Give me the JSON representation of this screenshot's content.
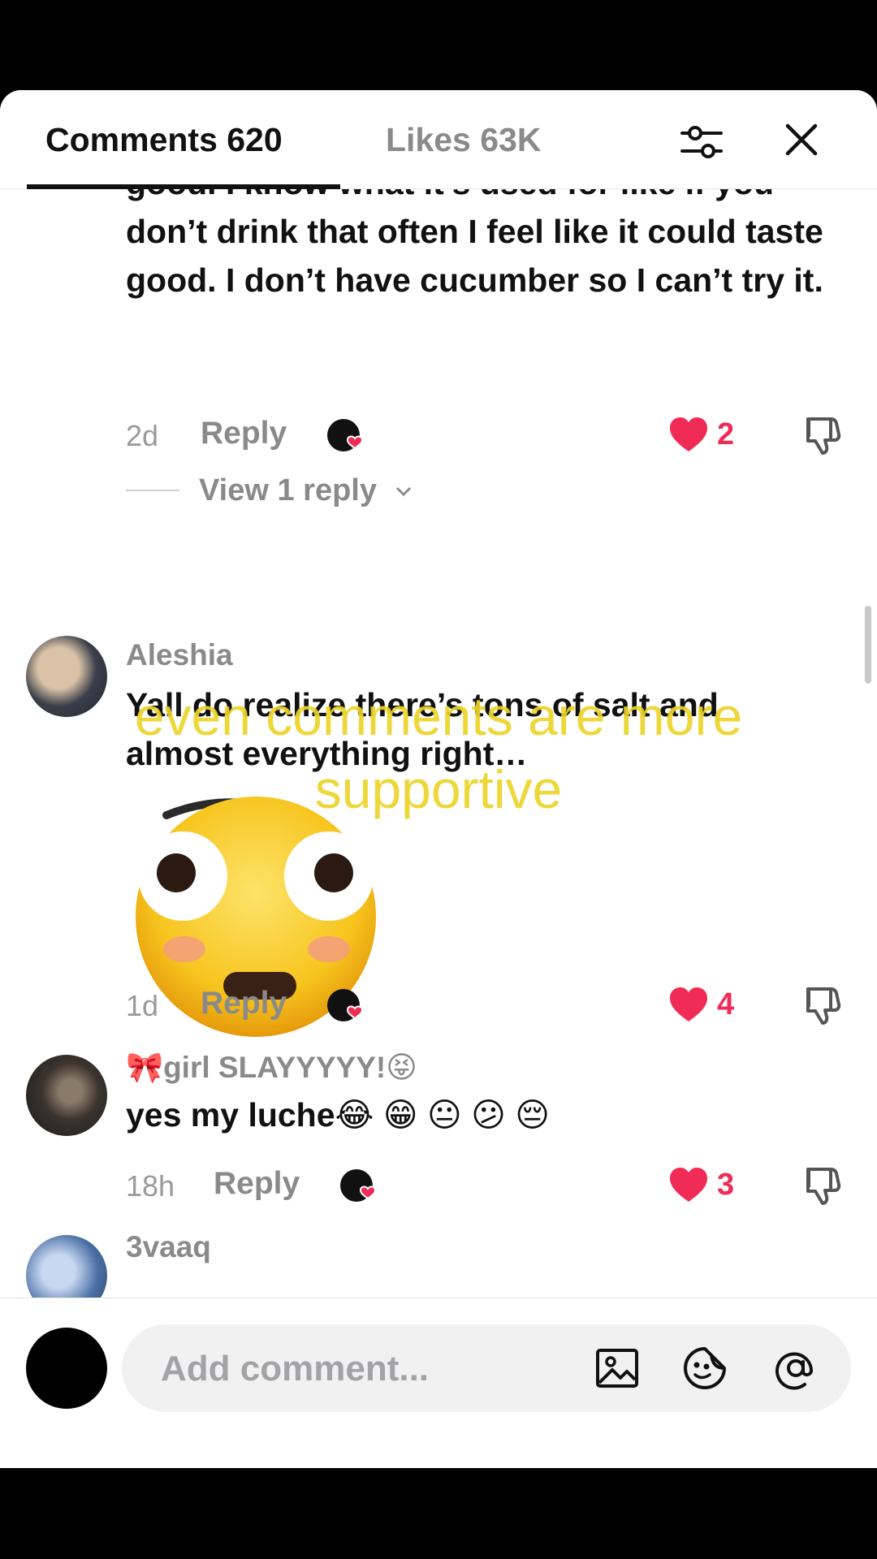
{
  "header": {
    "comments_tab": "Comments 620",
    "likes_tab": "Likes 63K",
    "filter_icon": "sliders-icon",
    "close_icon": "close-icon"
  },
  "comments": [
    {
      "text": "good. I know what it’s used for like if you don’t drink that often I feel like it could taste good. I don’t have cucumber so I can’t try it.",
      "time": "2d",
      "reply_label": "Reply",
      "likes": "2",
      "view_replies": "View 1 reply"
    },
    {
      "username": "Aleshia",
      "text": "Yall do realize there’s tons of salt and almost everything right…",
      "time": "1d",
      "reply_label": "Reply",
      "likes": "4"
    },
    {
      "username_emoji": "🎀",
      "username": "girl SLAYYYYY!",
      "username_suffix_emoji": "😝",
      "text": "yes my luche",
      "text_emojis": "😂 😁 😐 😕 😔",
      "time": "18h",
      "reply_label": "Reply",
      "likes": "3"
    },
    {
      "username": "3vaaq"
    }
  ],
  "overlay_caption": "even comments are more supportive",
  "composer": {
    "placeholder": "Add comment...",
    "icons": [
      "image-icon",
      "sticker-icon",
      "mention-icon"
    ]
  },
  "colors": {
    "like_red": "#f02c56",
    "overlay_yellow": "#ecd428"
  }
}
